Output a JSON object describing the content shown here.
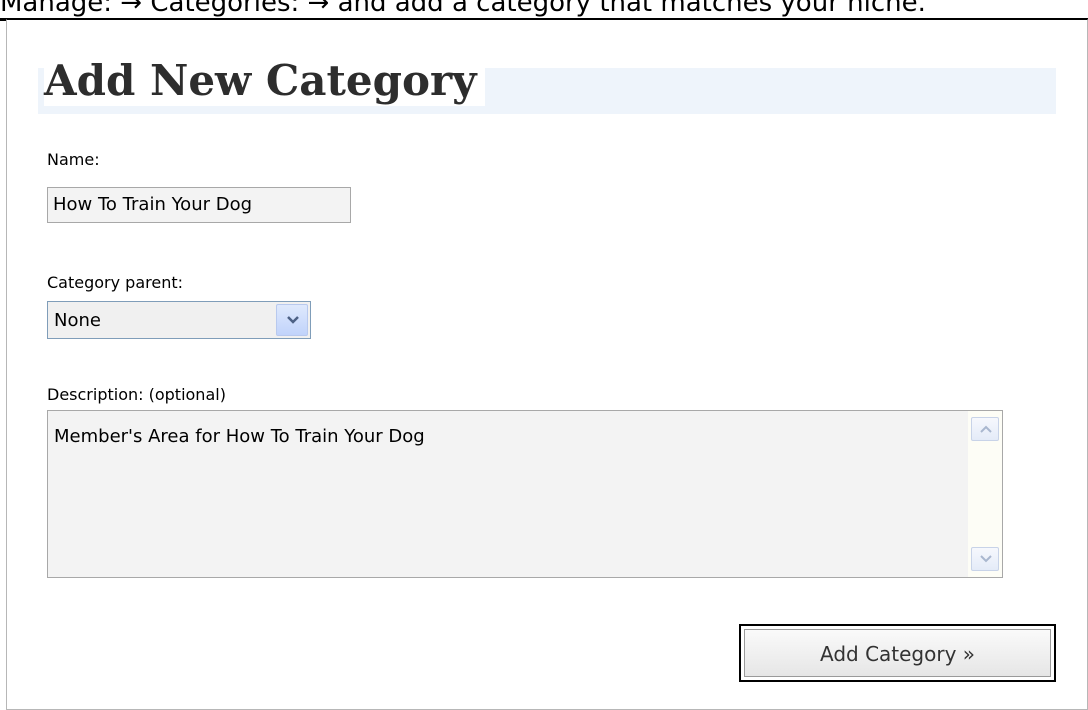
{
  "intro": {
    "text": "Manage: → Categories: → and add a category that matches your niche."
  },
  "form": {
    "title": "Add New Category",
    "name_label": "Name:",
    "name_value": "How To Train Your Dog",
    "parent_label": "Category parent:",
    "parent_selected": "None",
    "description_label": "Description: (optional)",
    "description_value": "Member's Area for How To Train Your Dog",
    "submit_label": "Add Category »"
  },
  "icons": {
    "select_arrow": "chevron-down-icon",
    "scroll_up": "chevron-up-icon",
    "scroll_down": "chevron-down-icon"
  },
  "colors": {
    "heading_band": "#eef4fb",
    "select_arrow_bg": "#c1d3fb",
    "field_bg": "#f3f3f3"
  }
}
